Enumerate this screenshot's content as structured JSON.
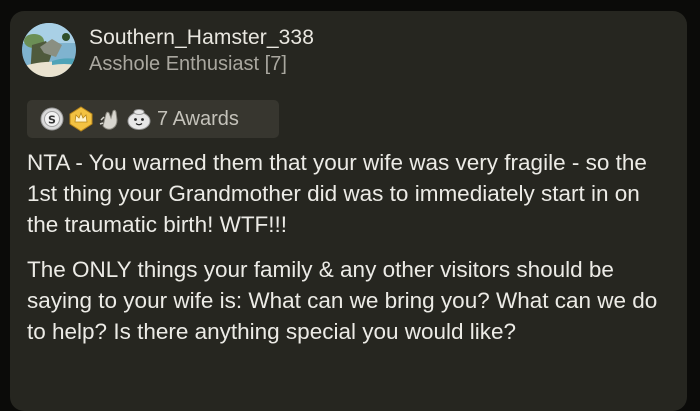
{
  "comment": {
    "author": "Southern_Hamster_338",
    "flair": "Asshole Enthusiast [7]",
    "awards": {
      "icons": [
        "silver-award-icon",
        "gold-crown-award-icon",
        "clapping-hands-award-icon",
        "wholesome-seal-award-icon"
      ],
      "count_label": "7 Awards"
    },
    "paragraphs": [
      "NTA - You warned them that your wife was very fragile - so the 1st thing your Grandmother did was to immediately start in on the traumatic birth! WTF!!!",
      "The ONLY things your family & any other visitors should be saying to your wife is: What can we bring you? What can we do to help? Is there anything special you would like?"
    ]
  },
  "colors": {
    "card_background": "#262620",
    "page_background": "#0b0b09",
    "awards_background": "#37362f",
    "text_primary": "#ecebe6",
    "text_secondary": "#a9a79f"
  }
}
